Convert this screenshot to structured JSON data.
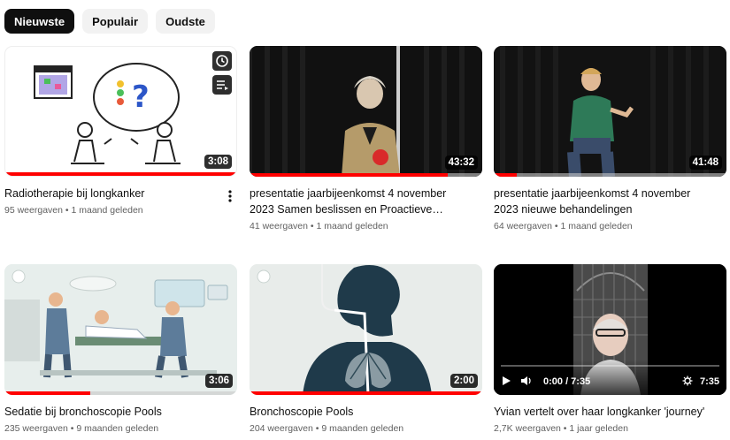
{
  "filters": {
    "chips": [
      {
        "label": "Nieuwste",
        "active": true
      },
      {
        "label": "Populair",
        "active": false
      },
      {
        "label": "Oudste",
        "active": false
      }
    ]
  },
  "videos": [
    {
      "title": "Radiotherapie bij longkanker",
      "meta": "95 weergaven • 1 maand geleden",
      "duration": "3:08",
      "progress": 1.0
    },
    {
      "title": "presentatie jaarbijeenkomst 4 november 2023 Samen beslissen en Proactieve…",
      "meta": "41 weergaven • 1 maand geleden",
      "duration": "43:32",
      "progress": 0.85
    },
    {
      "title": "presentatie jaarbijeenkomst 4 november 2023 nieuwe behandelingen",
      "meta": "64 weergaven • 1 maand geleden",
      "duration": "41:48",
      "progress": 0.1
    },
    {
      "title": "Sedatie bij bronchoscopie Pools",
      "meta": "235 weergaven • 9 maanden geleden",
      "duration": "3:06",
      "progress": 0.37
    },
    {
      "title": "Bronchoscopie Pools",
      "meta": "204 weergaven • 9 maanden geleden",
      "duration": "2:00",
      "progress": 1.0
    },
    {
      "title": "Yvian vertelt over haar longkanker 'journey'",
      "meta": "2,7K weergaven • 1 jaar geleden",
      "duration": "7:35",
      "progress": 0.0,
      "player_time": "0:00 / 7:35"
    }
  ],
  "icons": {
    "watch_later": "clock-icon",
    "add_to_queue": "queue-icon",
    "more": "more-vert-icon",
    "play": "play-icon",
    "volume": "volume-icon",
    "settings": "gear-icon"
  },
  "colors": {
    "accent": "#ff0000",
    "chip_active": "#0f0f0f",
    "chip_inactive": "#f2f2f2"
  }
}
